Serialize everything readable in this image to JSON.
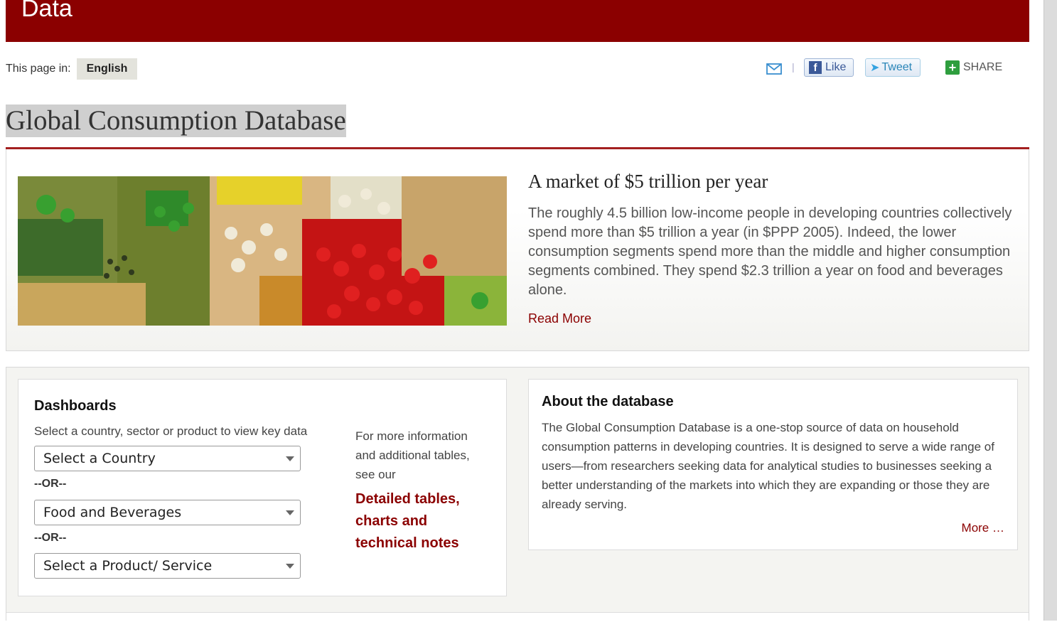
{
  "header": {
    "title": "Data",
    "background": "#8b0000"
  },
  "language": {
    "label": "This page in:",
    "current": "English"
  },
  "share": {
    "email_icon": "mail-icon",
    "separator": "|",
    "facebook_label": "Like",
    "twitter_label": "Tweet",
    "share_label": "SHARE"
  },
  "page": {
    "title": "Global Consumption Database",
    "accent": "#a31f1f"
  },
  "feature": {
    "image": "fruits-and-vegetables-market-photo",
    "heading": "A market of $5 trillion per year",
    "text": "The roughly 4.5 billion low-income people in developing countries collectively spend more than $5 trillion a year (in $PPP 2005). Indeed, the lower consumption segments spend more than the middle and higher consumption segments combined. They spend $2.3 trillion a year on food and beverages alone.",
    "read_more": "Read More"
  },
  "dashboards": {
    "title": "Dashboards",
    "subtitle": "Select a country, sector or product to view key data",
    "country_select": "Select a Country",
    "or_label": "--OR--",
    "sector_select": "Food and Beverages",
    "product_select": "Select a Product/ Service",
    "more_info": "For more information and additional tables, see our",
    "detail_link": "Detailed tables, charts and technical notes"
  },
  "about": {
    "title": "About the database",
    "text": "The Global Consumption Database is a one-stop source of data on household consumption patterns in developing countries. It is designed to serve a wide range of users—from researchers seeking data for analytical studies to businesses seeking a better understanding of the markets into which they are expanding or those they are already serving.",
    "more": "More …"
  }
}
